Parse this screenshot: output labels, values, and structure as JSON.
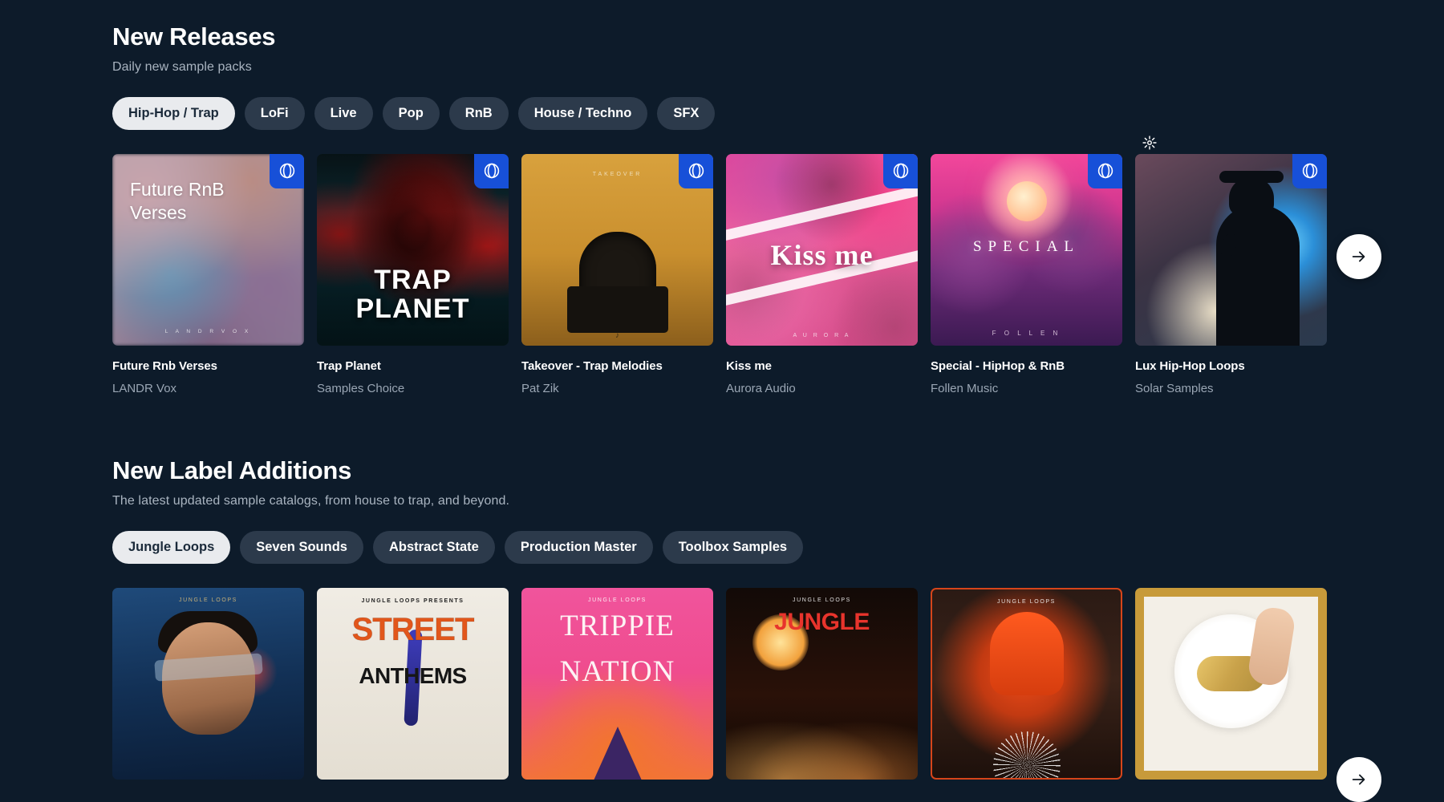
{
  "theme": {
    "background": "#0d1b2a",
    "pill_bg": "#2c3a4b",
    "pill_active_bg": "#e9ebee",
    "pill_active_text": "#1b2a3a",
    "badge_blue": "#1750d8",
    "title_color": "#ffffff",
    "subtitle_color": "#a9b4c0"
  },
  "sections": [
    {
      "title": "New Releases",
      "subtitle": "Daily new sample packs",
      "filters": [
        {
          "label": "Hip-Hop / Trap",
          "active": true
        },
        {
          "label": "LoFi",
          "active": false
        },
        {
          "label": "Live",
          "active": false
        },
        {
          "label": "Pop",
          "active": false
        },
        {
          "label": "RnB",
          "active": false
        },
        {
          "label": "House / Techno",
          "active": false
        },
        {
          "label": "SFX",
          "active": false
        }
      ],
      "next_label": "arrow-right-icon",
      "cards": [
        {
          "title": "Future Rnb Verses",
          "artist": "LANDR Vox",
          "art_text": "Future RnB\nVerses",
          "art_line1": "Future RnB",
          "art_line2": "Verses",
          "art_footer": "L A N D R   V O X",
          "badge": "landr-logo"
        },
        {
          "title": "Trap Planet",
          "artist": "Samples Choice",
          "art_line1": "TRAP",
          "art_line2": "PLANET",
          "badge": "landr-logo"
        },
        {
          "title": "Takeover - Trap Melodies",
          "artist": "Pat Zik",
          "art_top": "TAKEOVER",
          "art_footer": "♪",
          "badge": "landr-logo"
        },
        {
          "title": "Kiss me",
          "artist": "Aurora Audio",
          "art_line1": "Kiss me",
          "art_footer": "A U R O R A",
          "badge": "landr-logo"
        },
        {
          "title": "Special - HipHop & RnB",
          "artist": "Follen Music",
          "art_line1": "SPECIAL",
          "art_footer": "F O L L E N",
          "badge": "landr-logo"
        },
        {
          "title": "Lux Hip-Hop Loops",
          "artist": "Solar Samples",
          "badge": "landr-logo",
          "spinner": "loading-spinner-icon"
        }
      ]
    },
    {
      "title": "New Label Additions",
      "subtitle": "The latest updated sample catalogs, from house to trap, and beyond.",
      "filters": [
        {
          "label": "Jungle Loops",
          "active": true
        },
        {
          "label": "Seven Sounds",
          "active": false
        },
        {
          "label": "Abstract State",
          "active": false
        },
        {
          "label": "Production Master",
          "active": false
        },
        {
          "label": "Toolbox Samples",
          "active": false
        }
      ],
      "next_label": "arrow-right-icon",
      "cards": [
        {
          "art_top": "JUNGLE LOOPS"
        },
        {
          "art_top": "JUNGLE LOOPS PRESENTS",
          "art_line1": "STREET",
          "art_line2": "ANTHEMS"
        },
        {
          "art_top": "JUNGLE LOOPS",
          "art_line1": "TRIPPIE",
          "art_line2": "NATION"
        },
        {
          "art_top": "JUNGLE LOOPS",
          "art_line1": "JUNGLE"
        },
        {
          "art_top": "JUNGLE LOOPS"
        },
        {
          "art_top": ""
        }
      ]
    }
  ]
}
